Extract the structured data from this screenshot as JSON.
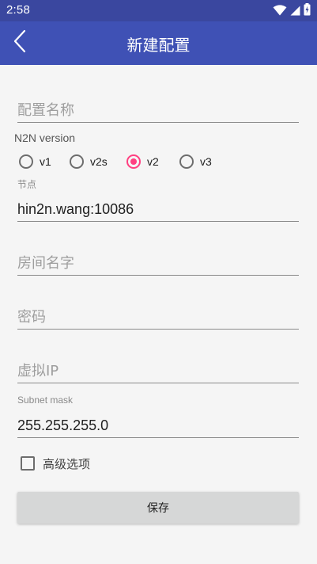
{
  "status_bar": {
    "time": "2:58",
    "icons": [
      "wifi-icon",
      "cell-signal-icon",
      "battery-icon"
    ]
  },
  "app_bar": {
    "title": "新建配置",
    "back_icon": "chevron-left-icon"
  },
  "form": {
    "config_name": {
      "placeholder": "配置名称",
      "value": ""
    },
    "n2n_version": {
      "label": "N2N version",
      "options": [
        {
          "label": "v1",
          "checked": false
        },
        {
          "label": "v2s",
          "checked": false
        },
        {
          "label": "v2",
          "checked": true
        },
        {
          "label": "v3",
          "checked": false
        }
      ]
    },
    "supernode": {
      "label": "节点",
      "value": "hin2n.wang:10086"
    },
    "room_name": {
      "placeholder": "房间名字",
      "value": ""
    },
    "password": {
      "placeholder": "密码",
      "value": ""
    },
    "virtual_ip": {
      "placeholder": "虚拟IP",
      "value": ""
    },
    "subnet_mask": {
      "label": "Subnet mask",
      "value": "255.255.255.0"
    },
    "advanced": {
      "label": "高级选项",
      "checked": false
    },
    "save_label": "保存"
  },
  "colors": {
    "status_bar": "#3a479f",
    "app_bar": "#3f51b5",
    "accent": "#ff4081",
    "background": "#f5f5f5",
    "button": "#d6d7d7"
  }
}
